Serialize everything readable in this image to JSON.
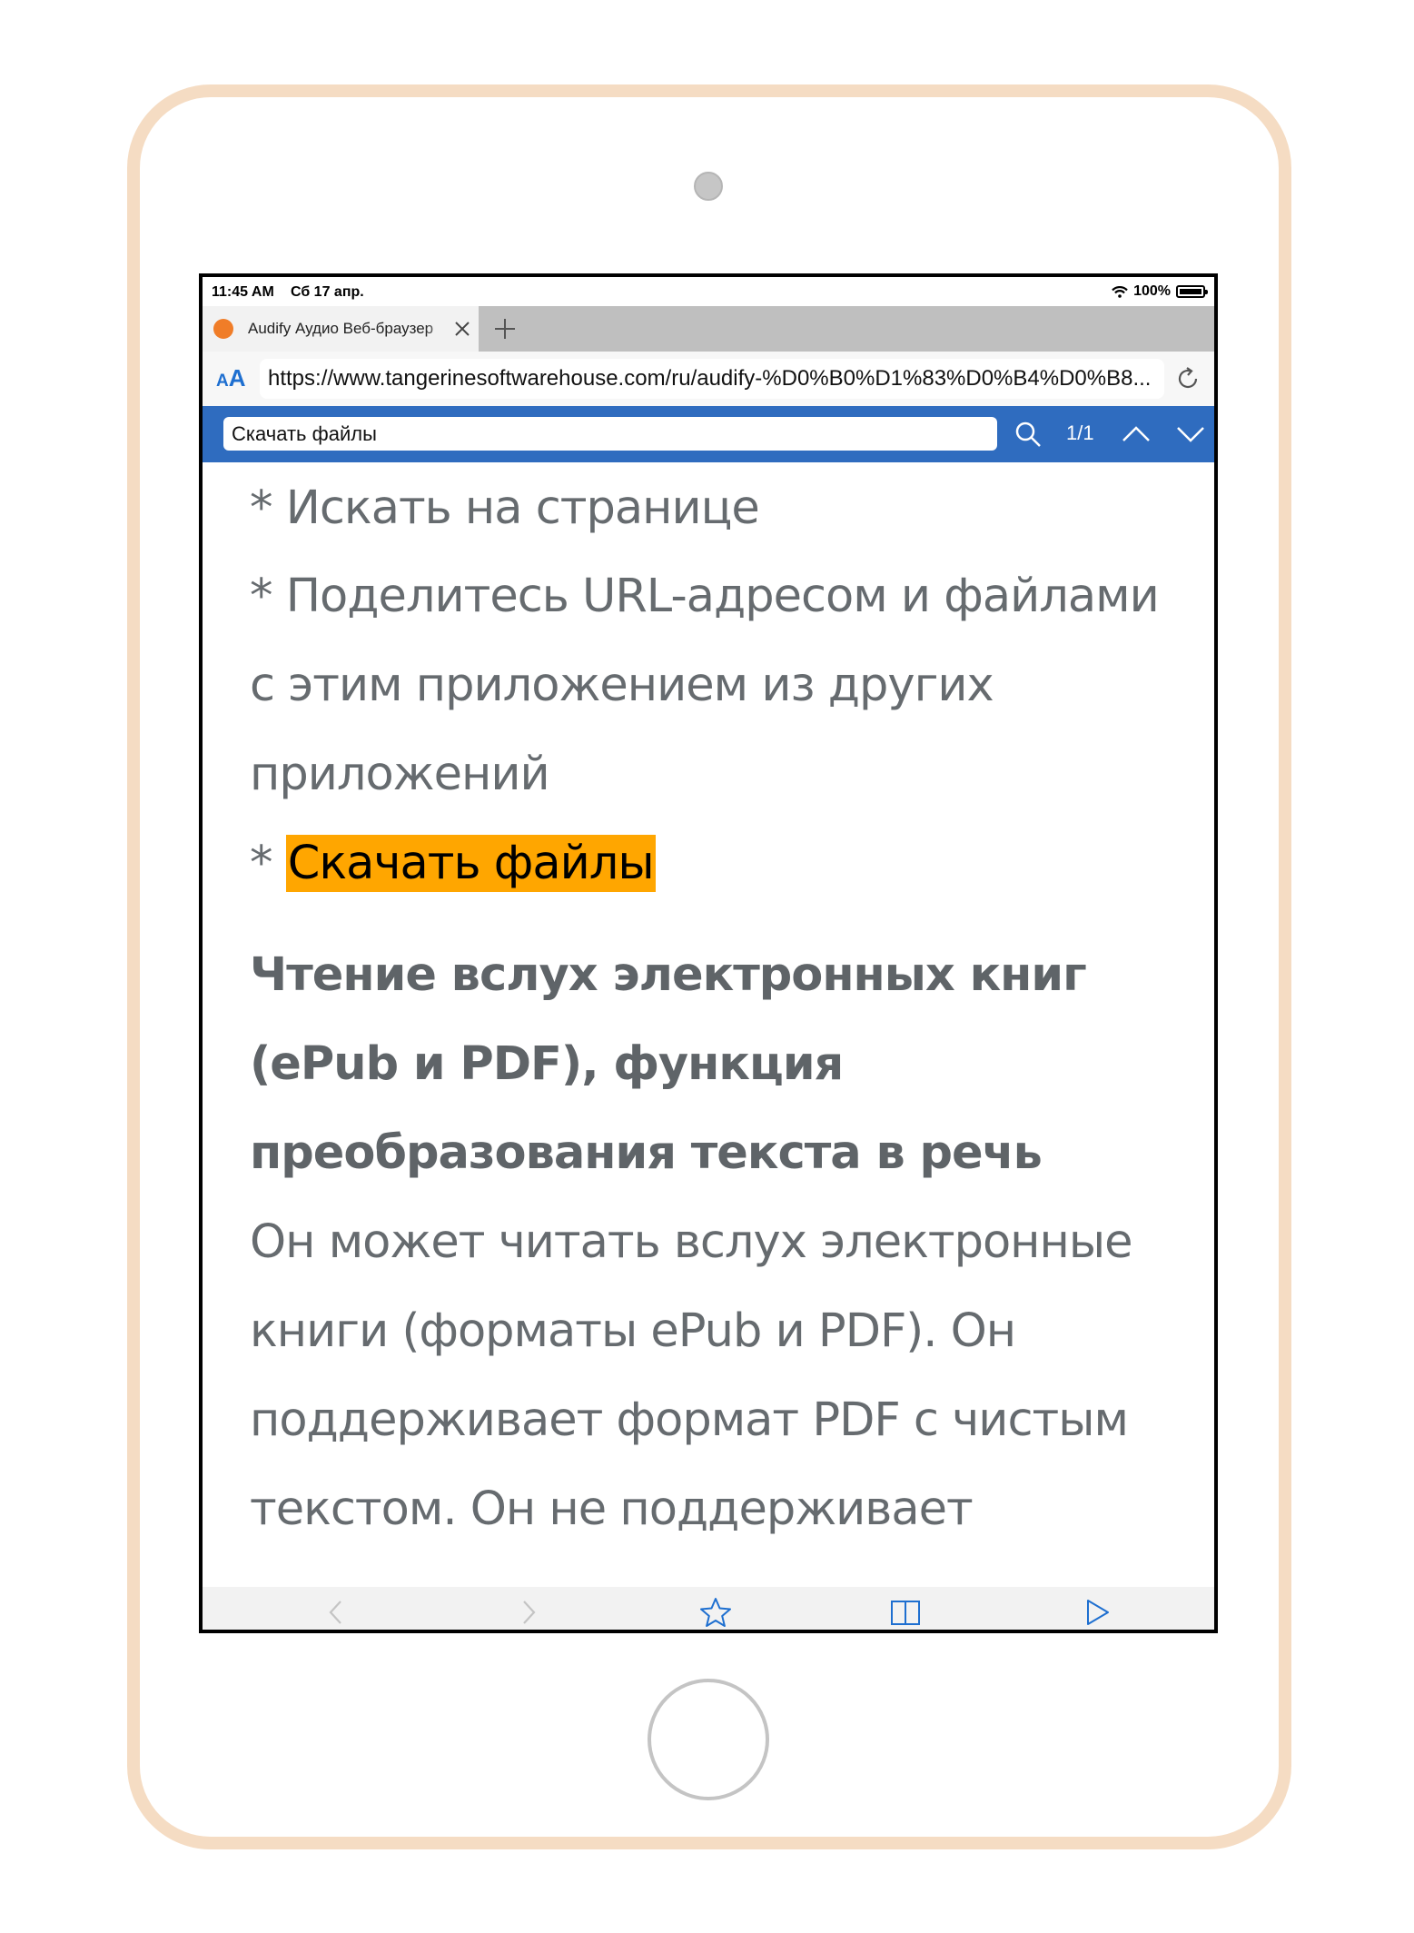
{
  "status_bar": {
    "time": "11:45 AM",
    "date": "Сб 17 апр.",
    "battery": "100%"
  },
  "tab": {
    "title": "Audify Аудио Веб-браузер",
    "favicon": "tangerine-favicon"
  },
  "url_bar": {
    "aa_small": "A",
    "aa_large": "A",
    "url": "https://www.tangerinesoftwarehouse.com/ru/audify-%D0%B0%D1%83%D0%B4%D0%B8..."
  },
  "find_bar": {
    "query": "Скачать файлы",
    "count": "1/1"
  },
  "content": {
    "lines": [
      "* Искать на странице",
      "* Поделитесь URL-адресом и файлами",
      "с этим приложением из других",
      "приложений"
    ],
    "bullet_prefix": "* ",
    "highlighted": "Скачать файлы",
    "heading_lines": [
      "Чтение вслух электронных книг",
      "(ePub и PDF), функция",
      "преобразования текста в речь"
    ],
    "paragraph_lines": [
      "Он может читать вслух электронные",
      "книги (форматы ePub и PDF). Он",
      "поддерживает формат PDF с чистым",
      "текстом. Он не поддерживает"
    ]
  },
  "colors": {
    "accent": "#2f6cbf",
    "highlight": "#ffa600",
    "frame": "#f5dcc3",
    "link": "#1e6fd0"
  },
  "icons": [
    "close-icon",
    "plus-icon",
    "reload-icon",
    "search-icon",
    "chevron-up-icon",
    "chevron-down-icon",
    "back-icon",
    "forward-icon",
    "star-icon",
    "book-icon",
    "play-icon"
  ]
}
